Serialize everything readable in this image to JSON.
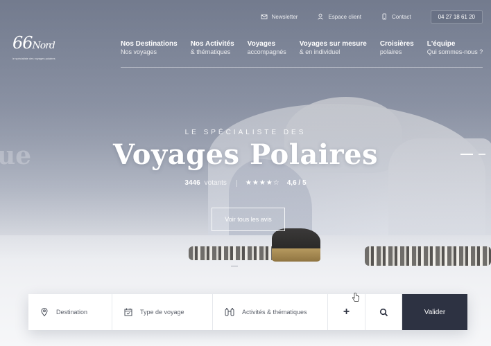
{
  "topbar": {
    "newsletter": "Newsletter",
    "client_area": "Espace client",
    "contact": "Contact",
    "phone": "04 27 18 61 20"
  },
  "logo": {
    "mark_number": "66",
    "mark_word": "Nord",
    "tagline": "le spécialiste des voyages polaires"
  },
  "nav": [
    {
      "title": "Nos Destinations",
      "sub": "Nos voyages"
    },
    {
      "title": "Nos Activités",
      "sub": "& thématiques"
    },
    {
      "title": "Voyages",
      "sub": "accompagnés"
    },
    {
      "title": "Voyages sur mesure",
      "sub": "& en individuel"
    },
    {
      "title": "Croisières",
      "sub": "polaires"
    },
    {
      "title": "L'équipe",
      "sub": "Qui sommes-nous ?"
    }
  ],
  "hero": {
    "eyebrow": "LE SPÉCIALISTE DES",
    "headline": "Voyages Polaires",
    "ghost_prev": "ue",
    "rating_count": "3446",
    "rating_label": "votants",
    "stars_display": "★★★★☆",
    "rating_value": 4.6,
    "rating_score": "4,6 / 5",
    "cta_label": "Voir tous les avis"
  },
  "search": {
    "destination": "Destination",
    "trip_type": "Type de voyage",
    "activities": "Activités & thématiques",
    "more": "+",
    "submit": "Valider"
  },
  "colors": {
    "navy": "#2d3242",
    "overlay": "#3e465c",
    "white": "#ffffff"
  },
  "icons": [
    "newsletter-icon",
    "user-icon",
    "phone-icon",
    "location-pin-icon",
    "calendar-icon",
    "binoculars-icon",
    "plus-icon",
    "search-icon"
  ]
}
